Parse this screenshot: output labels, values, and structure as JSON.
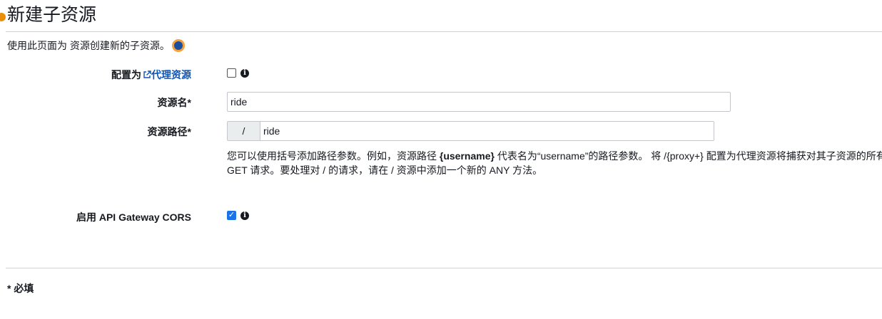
{
  "header": {
    "title": "新建子资源"
  },
  "intro": {
    "text": "使用此页面为 资源创建新的子资源。"
  },
  "proxy": {
    "label_prefix": "配置为",
    "link_text": "代理资源",
    "checked": false
  },
  "resource_name": {
    "label": "资源名*",
    "value": "ride"
  },
  "resource_path": {
    "label": "资源路径*",
    "prefix": "/",
    "value": "ride",
    "help": {
      "part1": "您可以使用括号添加路径参数。例如，资源路径 ",
      "param": "{username}",
      "part2": " 代表名为“username”的路径参数。 将 /{proxy+} 配置为代理资源将捕获对其子资源的所有请求。例如，它适用于对 /foo 的",
      "line2": "GET 请求。要处理对 / 的请求，请在 / 资源中添加一个新的 ANY 方法。"
    }
  },
  "cors": {
    "label": "启用 API Gateway CORS",
    "checked": true
  },
  "footer": {
    "required_note": "* 必填"
  },
  "icons": {
    "info": "info-icon",
    "external": "external-link-icon",
    "help": "help-circle-icon"
  },
  "colors": {
    "accent": "#eb8f0b",
    "link": "#0f55b5",
    "checkbox": "#1a73e8"
  }
}
